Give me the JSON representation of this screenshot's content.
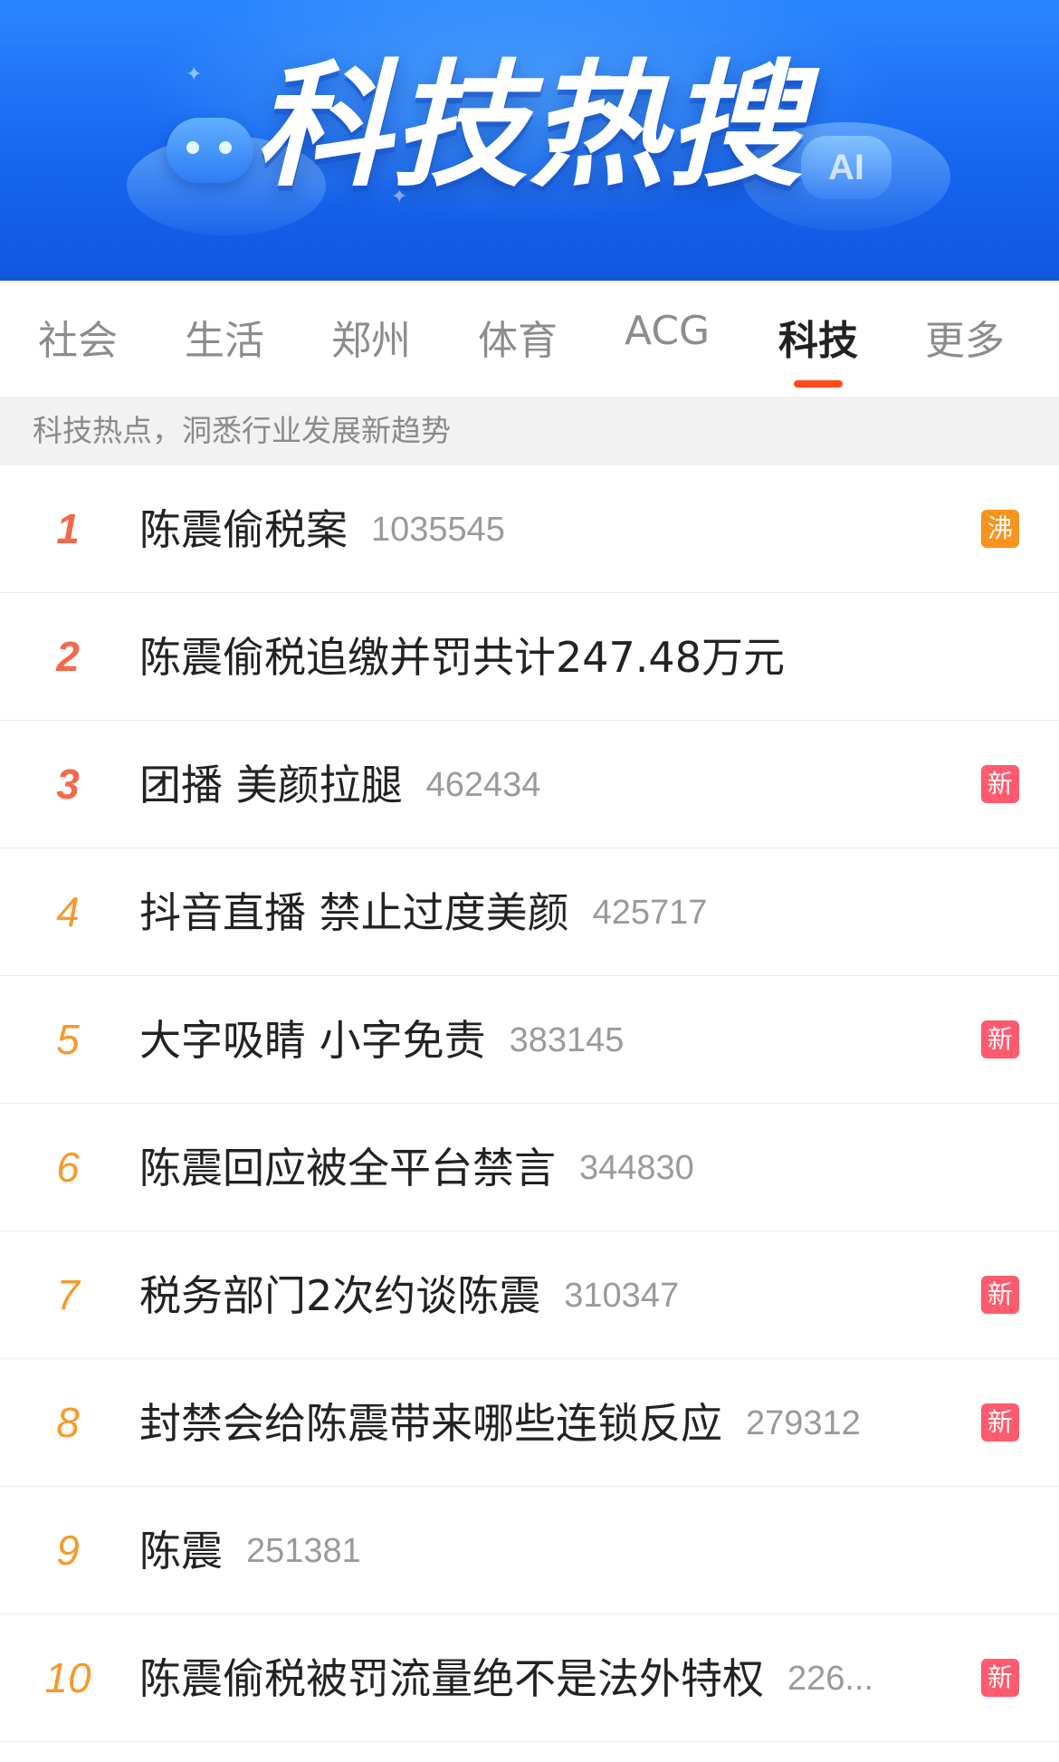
{
  "banner": {
    "title": "科技热搜",
    "ai_badge": "AI"
  },
  "tabs": [
    {
      "label": "社会",
      "active": false
    },
    {
      "label": "生活",
      "active": false
    },
    {
      "label": "郑州",
      "active": false
    },
    {
      "label": "体育",
      "active": false
    },
    {
      "label": "ACG",
      "active": false
    },
    {
      "label": "科技",
      "active": true
    },
    {
      "label": "更多",
      "active": false
    }
  ],
  "subtitle": "科技热点，洞悉行业发展新趋势",
  "colors": {
    "banner_blue": "#1767ef",
    "tab_indicator": "#ff4a1c",
    "rank_top": "#f26a4b",
    "rank_other": "#f59a2c",
    "tag_hot": "#f7931e",
    "tag_new": "#ff5a6e"
  },
  "list": [
    {
      "rank": "1",
      "title": "陈震偷税案",
      "count": "1035545",
      "tag": "沸",
      "tag_type": "hot"
    },
    {
      "rank": "2",
      "title": "陈震偷税追缴并罚共计247.48万元",
      "count": "",
      "tag": "",
      "tag_type": ""
    },
    {
      "rank": "3",
      "title": "团播 美颜拉腿",
      "count": "462434",
      "tag": "新",
      "tag_type": "new"
    },
    {
      "rank": "4",
      "title": "抖音直播 禁止过度美颜",
      "count": "425717",
      "tag": "",
      "tag_type": ""
    },
    {
      "rank": "5",
      "title": "大字吸睛 小字免责",
      "count": "383145",
      "tag": "新",
      "tag_type": "new"
    },
    {
      "rank": "6",
      "title": "陈震回应被全平台禁言",
      "count": "344830",
      "tag": "",
      "tag_type": ""
    },
    {
      "rank": "7",
      "title": "税务部门2次约谈陈震",
      "count": "310347",
      "tag": "新",
      "tag_type": "new"
    },
    {
      "rank": "8",
      "title": "封禁会给陈震带来哪些连锁反应",
      "count": "279312",
      "tag": "新",
      "tag_type": "new"
    },
    {
      "rank": "9",
      "title": "陈震",
      "count": "251381",
      "tag": "",
      "tag_type": ""
    },
    {
      "rank": "10",
      "title": "陈震偷税被罚流量绝不是法外特权",
      "count": "226...",
      "tag": "新",
      "tag_type": "new"
    }
  ]
}
